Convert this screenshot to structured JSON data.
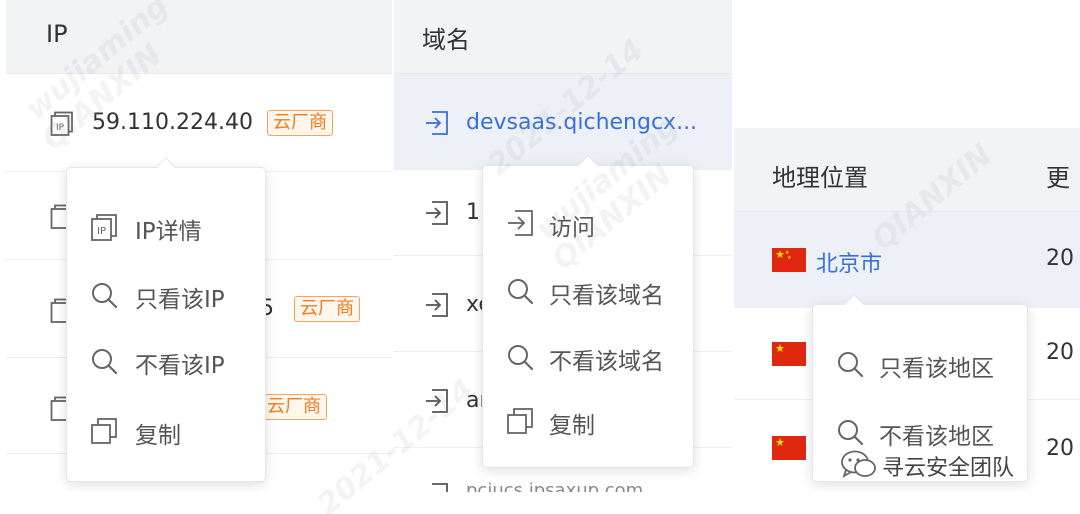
{
  "ip_panel": {
    "header": "IP",
    "rows": [
      {
        "ip": "59.110.224.40",
        "badge": "云厂商"
      },
      {
        "ip": "",
        "badge": ""
      },
      {
        "ip": "5",
        "badge": "云厂商"
      },
      {
        "ip": "",
        "badge": "云厂商"
      }
    ],
    "menu": [
      {
        "icon": "ip-detail-icon",
        "label": "IP详情"
      },
      {
        "icon": "search-icon",
        "label": "只看该IP"
      },
      {
        "icon": "search-icon",
        "label": "不看该IP"
      },
      {
        "icon": "copy-icon",
        "label": "复制"
      }
    ]
  },
  "domain_panel": {
    "header": "域名",
    "rows": [
      {
        "domain": "devsaas.qichengcx..."
      },
      {
        "domain": "1("
      },
      {
        "domain": "xe"
      },
      {
        "domain": "ar"
      },
      {
        "domain": "pciucs.ipsaxup.com"
      }
    ],
    "menu": [
      {
        "icon": "enter-icon",
        "label": "访问"
      },
      {
        "icon": "search-icon",
        "label": "只看该域名"
      },
      {
        "icon": "search-icon",
        "label": "不看该域名"
      },
      {
        "icon": "copy-icon",
        "label": "复制"
      }
    ]
  },
  "geo_panel": {
    "header": "地理位置",
    "header_next": "更",
    "rows": [
      {
        "location": "北京市",
        "next": "20"
      },
      {
        "location": "",
        "next": "20"
      },
      {
        "location": "",
        "next": "20"
      }
    ],
    "menu": [
      {
        "icon": "search-icon",
        "label": "只看该地区"
      },
      {
        "icon": "search-icon",
        "label": "不看该地区"
      }
    ]
  },
  "watermark": {
    "line1": "wujiaming",
    "line2": "QIANXIN",
    "line3": "2021-12-14"
  },
  "brand": {
    "text": "寻云安全团队",
    "icon": "wechat-icon"
  },
  "colors": {
    "link": "#3b6fd8",
    "badge": "#f07c1c",
    "header_bg": "#f2f3f5"
  }
}
